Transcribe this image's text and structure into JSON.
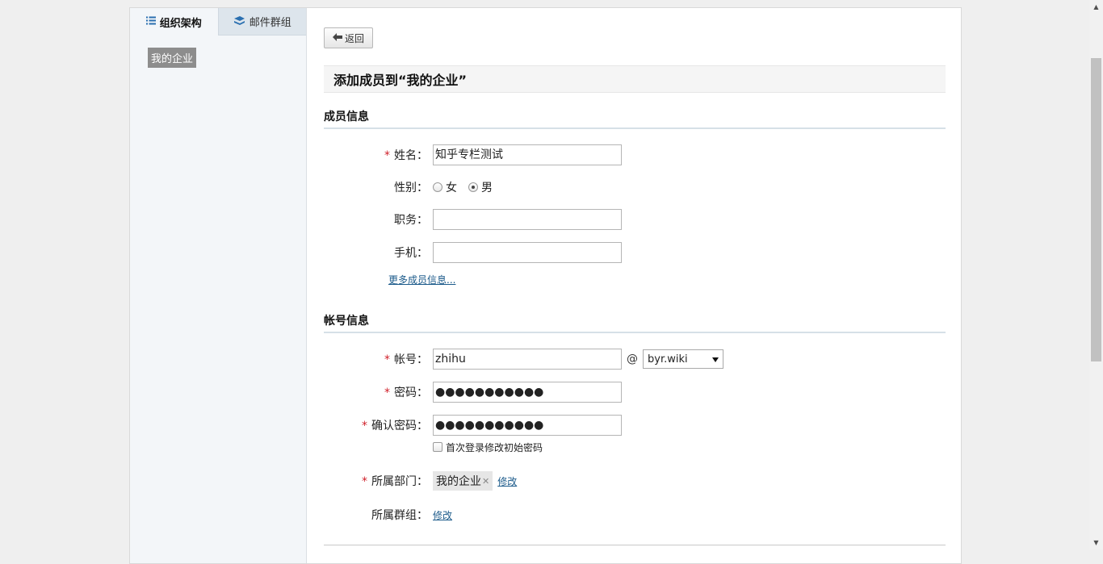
{
  "sidebar": {
    "tabs": [
      {
        "label": "组织架构",
        "icon": "list-icon"
      },
      {
        "label": "邮件群组",
        "icon": "mail-group-icon"
      }
    ],
    "tree_node": "我的企业"
  },
  "toolbar": {
    "back_label": "返回"
  },
  "page_title": "添加成员到“我的企业”",
  "member_section": {
    "title": "成员信息",
    "name_label": "姓名：",
    "name_value": "知乎专栏测试",
    "gender_label": "性别：",
    "gender_options": [
      "女",
      "男"
    ],
    "gender_selected": "男",
    "title_label": "职务：",
    "title_value": "",
    "phone_label": "手机：",
    "phone_value": "",
    "more_link": "更多成员信息..."
  },
  "account_section": {
    "title": "帐号信息",
    "account_label": "帐号：",
    "account_value": "zhihu",
    "at_sign": "@",
    "domain_value": "byr.wiki",
    "password_label": "密码：",
    "password_value": "●●●●●●●●●●●",
    "confirm_label": "确认密码：",
    "confirm_value": "●●●●●●●●●●●",
    "change_on_login_label": "首次登录修改初始密码",
    "dept_label": "所属部门：",
    "dept_tag": "我的企业",
    "dept_modify": "修改",
    "group_label": "所属群组：",
    "group_modify": "修改"
  },
  "colors": {
    "required": "#d0202a",
    "link": "#1b5a8a",
    "sidebar_bg": "#f3f6f9"
  }
}
